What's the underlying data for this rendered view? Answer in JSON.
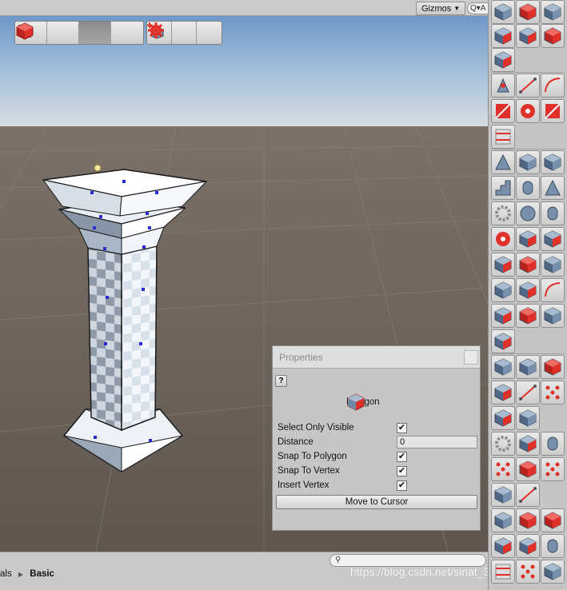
{
  "scene_header": {
    "gizmos_label": "Gizmos",
    "search_text": "Q▾A"
  },
  "toolbar": {
    "mode_buttons": [
      {
        "name": "object-mode",
        "icon": "cube-outline-icon",
        "active": false
      },
      {
        "name": "element-mode",
        "icon": "cube-icon",
        "active": false
      },
      {
        "name": "face-select-mode",
        "icon": "cube-face-icon",
        "active": true
      },
      {
        "name": "vertex-mode",
        "icon": "red-cube-icon",
        "active": false
      }
    ],
    "tool_buttons": [
      {
        "name": "shape-tool",
        "icon": "new-shape-icon"
      },
      {
        "name": "settings",
        "icon": "gear-icon"
      },
      {
        "name": "vertex-snap",
        "icon": "starburst-icon"
      }
    ]
  },
  "properties": {
    "title": "Properties",
    "help_label": "?",
    "header_label": "Polygon",
    "rows": [
      {
        "label": "Select Only Visible",
        "type": "checkbox",
        "checked": true
      },
      {
        "label": "Distance",
        "type": "field",
        "value": "0"
      },
      {
        "label": "Snap To Polygon",
        "type": "checkbox",
        "checked": true
      },
      {
        "label": "Snap To Vertex",
        "type": "checkbox",
        "checked": true
      },
      {
        "label": "Insert Vertex",
        "type": "checkbox",
        "checked": true
      }
    ],
    "checkmark": "✔",
    "move_button_label": "Move to Cursor"
  },
  "bottom": {
    "search_icon": "magnifier-icon",
    "search_glyph": "⚲",
    "crumb_first": "als",
    "crumb_sep": "▶",
    "crumb_last": "Basic",
    "watermark": "https://blog.csdn.net/sinat_38291823"
  },
  "colors": {
    "accent_red": "#e0302a",
    "cube_blue": "#6f88a6",
    "ground": "#6b625a",
    "sky_top": "#6a96c6"
  }
}
